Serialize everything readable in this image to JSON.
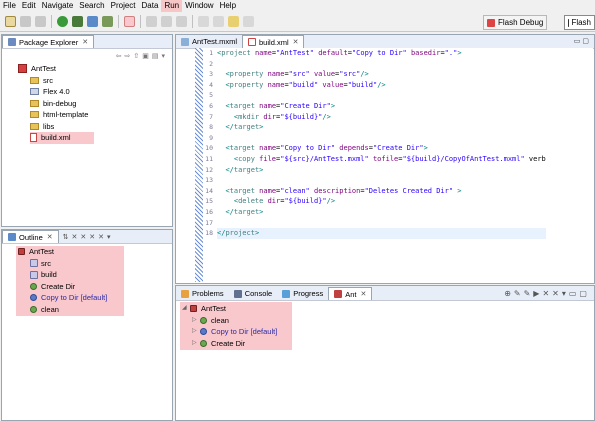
{
  "menu": [
    "File",
    "Edit",
    "Navigate",
    "Search",
    "Project",
    "Data",
    "Run",
    "Window",
    "Help"
  ],
  "menu_active": "Run",
  "perspectives": {
    "flash_debug": "Flash Debug",
    "flash": "Flash"
  },
  "package_explorer": {
    "tab_label": "Package Explorer",
    "project": "AntTest",
    "items": [
      "src",
      "Flex 4.0",
      "bin-debug",
      "html-template",
      "libs",
      "build.xml"
    ]
  },
  "editor": {
    "tabs": [
      "AntTest.mxml",
      "build.xml"
    ],
    "lines": [
      {
        "no": "1",
        "text": "<project name=\"AntTest\" default=\"Copy to Dir\" basedir=\".\">"
      },
      {
        "no": "2",
        "text": ""
      },
      {
        "no": "3",
        "text": "  <property name=\"src\" value=\"src\"/>"
      },
      {
        "no": "4",
        "text": "  <property name=\"build\" value=\"build\"/>"
      },
      {
        "no": "5",
        "text": ""
      },
      {
        "no": "6",
        "text": "  <target name=\"Create Dir\">"
      },
      {
        "no": "7",
        "text": "    <mkdir dir=\"${build}\"/>"
      },
      {
        "no": "8",
        "text": "  </target>"
      },
      {
        "no": "9",
        "text": ""
      },
      {
        "no": "10",
        "text": "  <target name=\"Copy to Dir\" depends=\"Create Dir\">"
      },
      {
        "no": "11",
        "text": "    <copy file=\"${src}/AntTest.mxml\" tofile=\"${build}/CopyOfAntTest.mxml\" verb"
      },
      {
        "no": "12",
        "text": "  </target>"
      },
      {
        "no": "13",
        "text": ""
      },
      {
        "no": "14",
        "text": "  <target name=\"clean\" description=\"Deletes Created Dir\" >"
      },
      {
        "no": "15",
        "text": "    <delete dir=\"${build}\"/>"
      },
      {
        "no": "16",
        "text": "  </target>"
      },
      {
        "no": "17",
        "text": ""
      },
      {
        "no": "18",
        "text": "</project>"
      }
    ]
  },
  "outline": {
    "tab_label": "Outline",
    "root": "AntTest",
    "items": [
      "src",
      "build",
      "Create Dir",
      "Copy to Dir [default]",
      "clean"
    ]
  },
  "bottom": {
    "tabs": [
      "Problems",
      "Console",
      "Progress",
      "Ant"
    ],
    "root": "AntTest",
    "items": [
      "clean",
      "Copy to Dir [default]",
      "Create Dir"
    ]
  }
}
